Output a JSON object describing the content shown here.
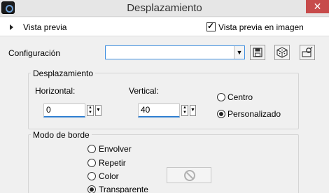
{
  "window": {
    "title": "Desplazamiento",
    "close_glyph": "✕"
  },
  "preview": {
    "label": "Vista previa",
    "image_preview_label": "Vista previa en imagen",
    "image_preview_checked": true
  },
  "config": {
    "label": "Configuración",
    "value": "",
    "buttons": [
      "save-icon",
      "dice-icon",
      "preset-manager-icon"
    ]
  },
  "offset_group": {
    "title": "Desplazamiento",
    "horizontal_label": "Horizontal:",
    "horizontal_value": "0",
    "vertical_label": "Vertical:",
    "vertical_value": "40",
    "options": [
      {
        "label": "Centro",
        "selected": false
      },
      {
        "label": "Personalizado",
        "selected": true
      }
    ]
  },
  "edge_group": {
    "title": "Modo de borde",
    "options": [
      {
        "label": "Envolver",
        "selected": false
      },
      {
        "label": "Repetir",
        "selected": false
      },
      {
        "label": "Color",
        "selected": false
      },
      {
        "label": "Transparente",
        "selected": true
      }
    ]
  },
  "colors": {
    "accent": "#2e7fd1",
    "close": "#c74b4b"
  }
}
